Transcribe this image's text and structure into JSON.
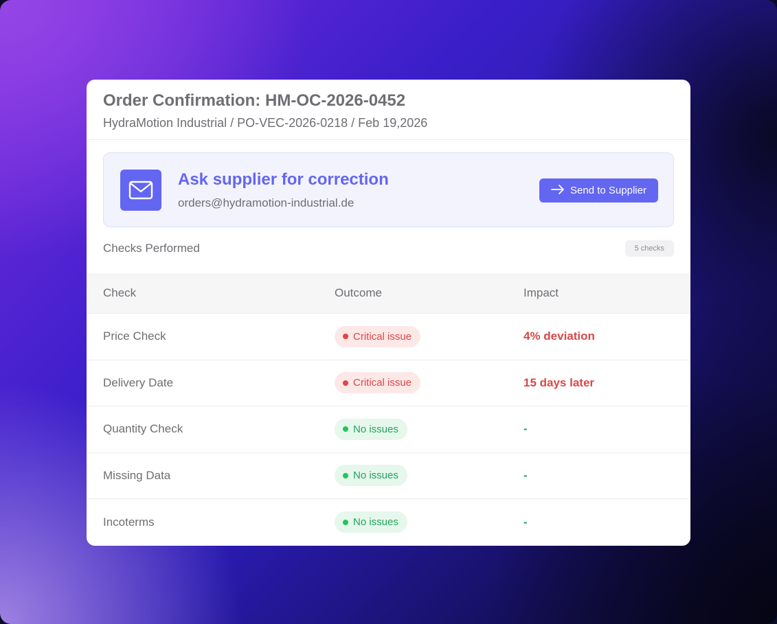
{
  "header": {
    "title": "Order Confirmation: HM-OC-2026-0452",
    "subtitle": "HydraMotion Industrial / PO-VEC-2026-0218 / Feb 19,2026"
  },
  "alert": {
    "icon": "mail-icon",
    "title": "Ask supplier for correction",
    "email": "orders@hydramotion-industrial.de",
    "button_label": "Send to Supplier",
    "button_icon": "arrow-right-icon"
  },
  "checks": {
    "label": "Checks Performed",
    "count": "5 checks"
  },
  "table": {
    "columns": [
      "Check",
      "Outcome",
      "Impact"
    ],
    "rows": [
      {
        "check": "Price Check",
        "outcome": "Critical issue",
        "status": "critical",
        "impact": "4% deviation"
      },
      {
        "check": "Delivery Date",
        "outcome": "Critical issue",
        "status": "critical",
        "impact": "15 days later"
      },
      {
        "check": "Quantity Check",
        "outcome": "No issues",
        "status": "ok",
        "impact": "-"
      },
      {
        "check": "Missing Data",
        "outcome": "No issues",
        "status": "ok",
        "impact": "-"
      },
      {
        "check": "Incoterms",
        "outcome": "No issues",
        "status": "ok",
        "impact": "-"
      }
    ]
  },
  "colors": {
    "accent": "#6366f1",
    "critical": "#d94848",
    "ok": "#22a45a"
  }
}
